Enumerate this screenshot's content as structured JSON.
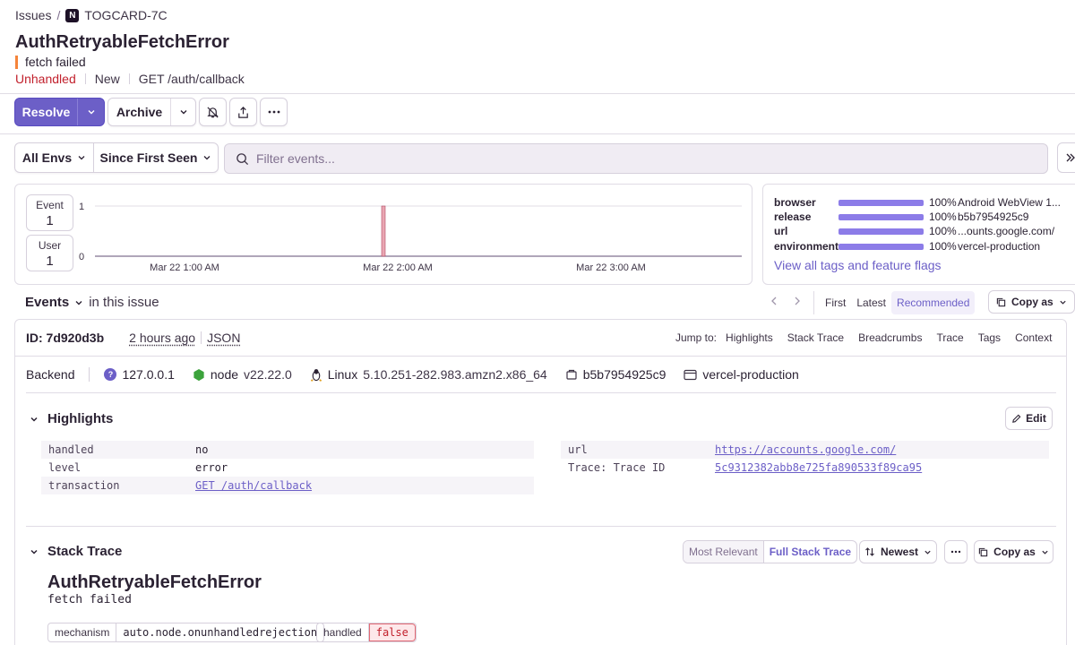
{
  "breadcrumb": {
    "issues": "Issues",
    "separator": "/",
    "project_icon": "N",
    "short_id": "TOGCARD-7C"
  },
  "issue": {
    "title": "AuthRetryableFetchError",
    "message": "fetch failed",
    "status": "Unhandled",
    "substatus": "New",
    "culprit": "GET /auth/callback"
  },
  "actions": {
    "resolve": "Resolve",
    "archive": "Archive"
  },
  "filters": {
    "envs": "All Envs",
    "period": "Since First Seen",
    "search_placeholder": "Filter events..."
  },
  "stats": {
    "event_label": "Event",
    "event_count": "1",
    "user_label": "User",
    "user_count": "1"
  },
  "chart_data": {
    "type": "bar",
    "x_ticks": [
      "Mar 22 1:00 AM",
      "Mar 22 2:00 AM",
      "Mar 22 3:00 AM"
    ],
    "y_ticks": [
      "1",
      "0"
    ],
    "ylim": [
      0,
      1
    ],
    "series": [
      {
        "values": [
          1
        ]
      }
    ],
    "bar_color": "#e9a6b2"
  },
  "tags": [
    {
      "key": "browser",
      "pct": "100%",
      "value": "Android WebView 1..."
    },
    {
      "key": "release",
      "pct": "100%",
      "value": "b5b7954925c9"
    },
    {
      "key": "url",
      "pct": "100%",
      "value": "...ounts.google.com/"
    },
    {
      "key": "environment",
      "pct": "100%",
      "value": "vercel-production"
    }
  ],
  "tags_link": "View all tags and feature flags",
  "events": {
    "title": "Events",
    "scope": "in this issue",
    "nav": {
      "first": "First",
      "latest": "Latest",
      "recommended": "Recommended"
    },
    "copy_as": "Copy as"
  },
  "event": {
    "id": "ID: 7d920d3b",
    "time": "2 hours ago",
    "json": "JSON",
    "jump_label": "Jump to:",
    "jump_links": [
      "Highlights",
      "Stack Trace",
      "Breadcrumbs",
      "Trace",
      "Tags",
      "Context"
    ]
  },
  "context": {
    "backend": "Backend",
    "ip": "127.0.0.1",
    "runtime": "node",
    "runtime_version": "v22.22.0",
    "os": "Linux",
    "os_version": "5.10.251-282.983.amzn2.x86_64",
    "release": "b5b7954925c9",
    "environment": "vercel-production"
  },
  "highlights": {
    "title": "Highlights",
    "edit": "Edit",
    "left": [
      {
        "key": "handled",
        "value": "no"
      },
      {
        "key": "level",
        "value": "error"
      },
      {
        "key": "transaction",
        "value": "GET /auth/callback"
      }
    ],
    "right": [
      {
        "key": "url",
        "value": "https://accounts.google.com/"
      },
      {
        "key": "Trace: Trace ID",
        "value": "5c9312382abb8e725fa890533f89ca95"
      }
    ]
  },
  "stack_trace": {
    "title": "Stack Trace",
    "most_relevant": "Most Relevant",
    "full": "Full Stack Trace",
    "sort": "Newest",
    "copy_as": "Copy as",
    "exception_type": "AuthRetryableFetchError",
    "exception_value": "fetch failed",
    "mechanism_key": "mechanism",
    "mechanism_value": "auto.node.onunhandledrejection",
    "handled_key": "handled",
    "handled_value": "false"
  }
}
